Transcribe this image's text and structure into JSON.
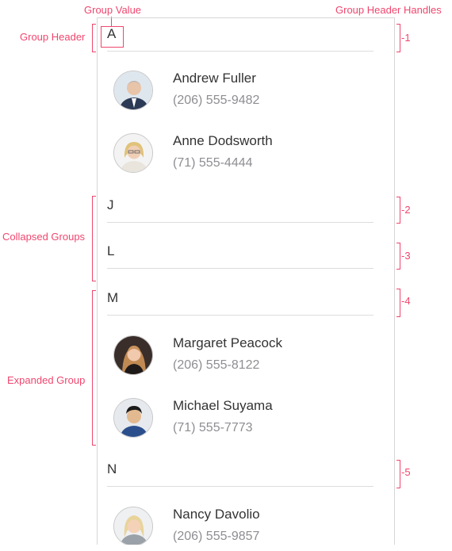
{
  "callouts": {
    "group_value": "Group Value",
    "group_header_handles": "Group Header Handles",
    "group_header": "Group Header",
    "collapsed_groups": "Collapsed Groups",
    "expanded_group": "Expanded Group"
  },
  "handles": [
    "-1",
    "-2",
    "-3",
    "-4",
    "-5"
  ],
  "groups": [
    {
      "letter": "A",
      "expanded": true,
      "contacts": [
        {
          "name": "Andrew Fuller",
          "phone": "(206) 555-9482"
        },
        {
          "name": "Anne Dodsworth",
          "phone": "(71) 555-4444"
        }
      ]
    },
    {
      "letter": "J",
      "expanded": false,
      "contacts": []
    },
    {
      "letter": "L",
      "expanded": false,
      "contacts": []
    },
    {
      "letter": "M",
      "expanded": true,
      "contacts": [
        {
          "name": "Margaret Peacock",
          "phone": "(206) 555-8122"
        },
        {
          "name": "Michael Suyama",
          "phone": "(71) 555-7773"
        }
      ]
    },
    {
      "letter": "N",
      "expanded": true,
      "contacts": [
        {
          "name": "Nancy Davolio",
          "phone": "(206) 555-9857"
        }
      ]
    }
  ],
  "colors": {
    "accent": "#f0466e",
    "separator": "#dcdcdc",
    "phone": "#8e8e93"
  }
}
